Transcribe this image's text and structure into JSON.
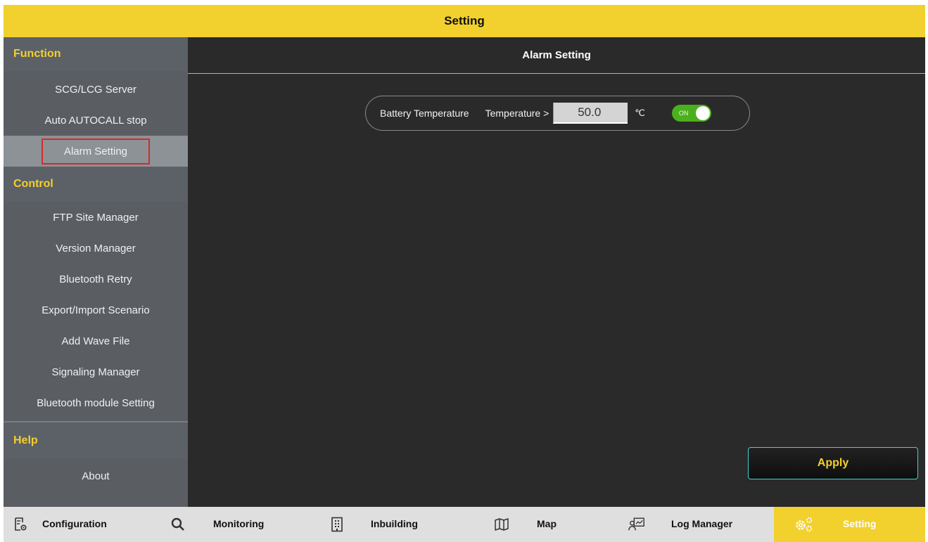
{
  "title": "Setting",
  "sidebar": {
    "sections": [
      {
        "label": "Function",
        "items": [
          "SCG/LCG Server",
          "Auto AUTOCALL stop",
          "Alarm Setting"
        ]
      },
      {
        "label": "Control",
        "items": [
          "FTP Site Manager",
          "Version Manager",
          "Bluetooth Retry",
          "Export/Import Scenario",
          "Add Wave File",
          "Signaling Manager",
          "Bluetooth module Setting"
        ]
      },
      {
        "label": "Help",
        "items": [
          "About"
        ]
      }
    ],
    "active_item": "Alarm Setting"
  },
  "main": {
    "header": "Alarm Setting",
    "alarm": {
      "name": "Battery Temperature",
      "condition": "Temperature >",
      "value": "50.0",
      "unit": "℃",
      "toggle_label": "ON",
      "enabled": true
    },
    "apply_label": "Apply"
  },
  "tabs": [
    {
      "label": "Configuration",
      "icon": "configuration-icon"
    },
    {
      "label": "Monitoring",
      "icon": "search-icon"
    },
    {
      "label": "Inbuilding",
      "icon": "building-icon"
    },
    {
      "label": "Map",
      "icon": "map-icon"
    },
    {
      "label": "Log Manager",
      "icon": "log-manager-icon"
    },
    {
      "label": "Setting",
      "icon": "gears-icon",
      "active": true
    }
  ],
  "colors": {
    "accent_yellow": "#f2d02e",
    "apply_border": "#3fd4c8",
    "toggle_green": "#4caf1e",
    "selection_outline": "#d42a2a"
  }
}
